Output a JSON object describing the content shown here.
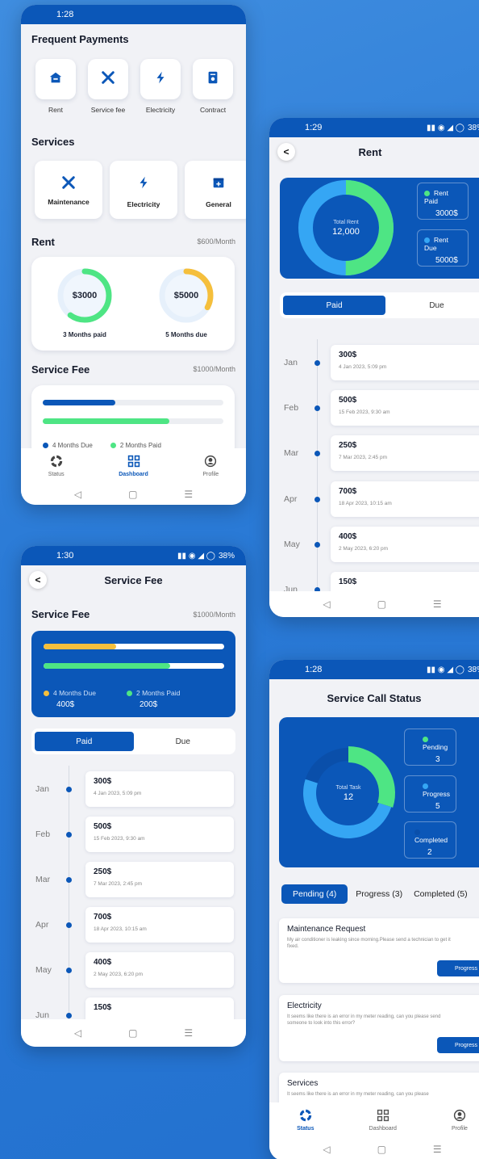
{
  "colors": {
    "primary": "#0b57b8",
    "green": "#4ee584",
    "lightblue": "#35a6f4",
    "yellow": "#f5bf3c"
  },
  "dashboard": {
    "time": "1:28",
    "frequent_title": "Frequent Payments",
    "frequent": [
      {
        "label": "Rent",
        "icon": "house-icon"
      },
      {
        "label": "Service fee",
        "icon": "tools-icon"
      },
      {
        "label": "Electricity",
        "icon": "bolt-icon"
      },
      {
        "label": "Contract",
        "icon": "document-icon"
      }
    ],
    "services_title": "Services",
    "services": [
      {
        "label": "Maintenance",
        "icon": "tools-icon"
      },
      {
        "label": "Electricity",
        "icon": "bolt-icon"
      },
      {
        "label": "General",
        "icon": "calendar-icon"
      }
    ],
    "rent_title": "Rent",
    "rent_rate": "$600/Month",
    "rent_paid": {
      "amount": "$3000",
      "label": "3 Months paid",
      "fraction": 0.6
    },
    "rent_due": {
      "amount": "$5000",
      "label": "5 Months due",
      "fraction": 0.33
    },
    "fee_title": "Service Fee",
    "fee_rate": "$1000/Month",
    "fee_bar_due": 0.4,
    "fee_bar_paid": 0.7,
    "fee_legend_due": "4 Months Due",
    "fee_legend_paid": "2 Months Paid",
    "nav": {
      "status": "Status",
      "dashboard": "Dashboard",
      "profile": "Profile"
    }
  },
  "rent_screen": {
    "time": "1:29",
    "signal": "38%",
    "title": "Rent",
    "chart_center_label": "Total Rent",
    "chart_center_value": "12,000",
    "chart_paid_fraction": 0.5,
    "paid_label": "Rent Paid",
    "paid_value": "3000$",
    "due_label": "Rent Due",
    "due_value": "5000$",
    "toggle": [
      "Paid",
      "Due"
    ],
    "timeline": [
      {
        "month": "Jan",
        "amount": "300$",
        "date": "4 Jan 2023, 5:09 pm"
      },
      {
        "month": "Feb",
        "amount": "500$",
        "date": "15 Feb 2023, 9:30 am"
      },
      {
        "month": "Mar",
        "amount": "250$",
        "date": "7 Mar 2023, 2:45 pm"
      },
      {
        "month": "Apr",
        "amount": "700$",
        "date": "18 Apr 2023, 10:15 am"
      },
      {
        "month": "May",
        "amount": "400$",
        "date": "2 May 2023, 6:20 pm"
      },
      {
        "month": "Jun",
        "amount": "150$",
        "date": ""
      }
    ]
  },
  "fee_screen": {
    "time": "1:30",
    "signal": "38%",
    "title": "Service Fee",
    "section": "Service Fee",
    "rate": "$1000/Month",
    "bar_due": 0.4,
    "bar_paid": 0.7,
    "due_label": "4 Months Due",
    "due_value": "400$",
    "paid_label": "2 Months Paid",
    "paid_value": "200$",
    "toggle": [
      "Paid",
      "Due"
    ],
    "timeline": [
      {
        "month": "Jan",
        "amount": "300$",
        "date": "4 Jan 2023, 5:09 pm"
      },
      {
        "month": "Feb",
        "amount": "500$",
        "date": "15 Feb 2023, 9:30 am"
      },
      {
        "month": "Mar",
        "amount": "250$",
        "date": "7 Mar 2023, 2:45 pm"
      },
      {
        "month": "Apr",
        "amount": "700$",
        "date": "18 Apr 2023, 10:15 am"
      },
      {
        "month": "May",
        "amount": "400$",
        "date": "2 May 2023, 6:20 pm"
      },
      {
        "month": "Jun",
        "amount": "150$",
        "date": ""
      }
    ]
  },
  "status_screen": {
    "time": "1:28",
    "signal": "38%",
    "title": "Service Call Status",
    "chart_center_label": "Total Task",
    "chart_center_value": "12",
    "legend": [
      {
        "label": "Pending",
        "value": "3"
      },
      {
        "label": "Progress",
        "value": "5"
      },
      {
        "label": "Completed",
        "value": "2"
      }
    ],
    "tabs": [
      "Pending (4)",
      "Progress (3)",
      "Completed (5)"
    ],
    "tasks": [
      {
        "title": "Maintenance Request",
        "desc": "My air conditioner is leaking since morning.Please send a technician to get it fixed.",
        "button": "Progress"
      },
      {
        "title": "Electricity",
        "desc": "It seems like there is an error in my meter reading, can you please send someone to look into this error?",
        "button": "Progress"
      },
      {
        "title": "Services",
        "desc": "It seems like there is an error in my meter reading, can you please"
      }
    ],
    "nav": {
      "status": "Status",
      "dashboard": "Dashboard",
      "profile": "Profile"
    }
  }
}
